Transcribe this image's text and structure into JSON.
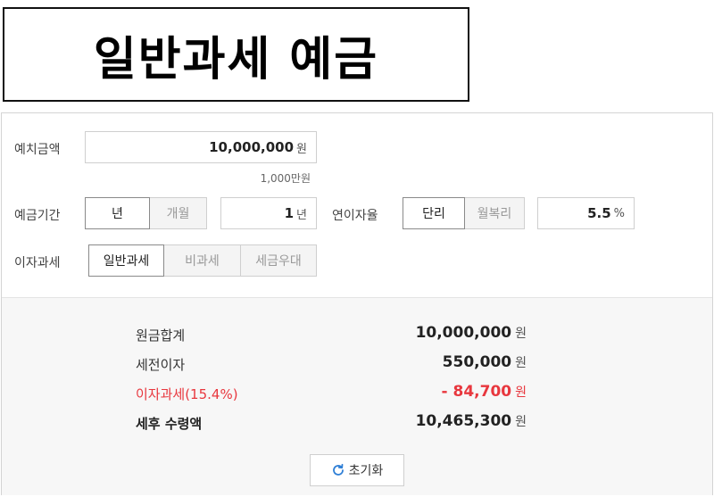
{
  "title": "일반과세 예금",
  "form": {
    "deposit_label": "예치금액",
    "deposit_value": "10,000,000",
    "deposit_unit": "원",
    "deposit_hint": "1,000만원",
    "period_label": "예금기간",
    "period_year_option": "년",
    "period_month_option": "개월",
    "period_value": "1",
    "period_unit": "년",
    "rate_label": "연이자율",
    "rate_simple_option": "단리",
    "rate_compound_option": "월복리",
    "rate_value": "5.5",
    "rate_unit": "%",
    "tax_label": "이자과세",
    "tax_general_option": "일반과세",
    "tax_exempt_option": "비과세",
    "tax_preferential_option": "세금우대"
  },
  "results": {
    "principal_label": "원금합계",
    "principal_value": "10,000,000",
    "pretax_label": "세전이자",
    "pretax_value": "550,000",
    "tax_label": "이자과세(15.4%)",
    "tax_value": "- 84,700",
    "net_label": "세후 수령액",
    "net_value": "10,465,300",
    "unit": "원"
  },
  "reset_label": "초기화",
  "colors": {
    "accent_red": "#e8373e",
    "refresh_icon": "#2f7fd6"
  },
  "icons": {
    "reset": "refresh-icon"
  }
}
